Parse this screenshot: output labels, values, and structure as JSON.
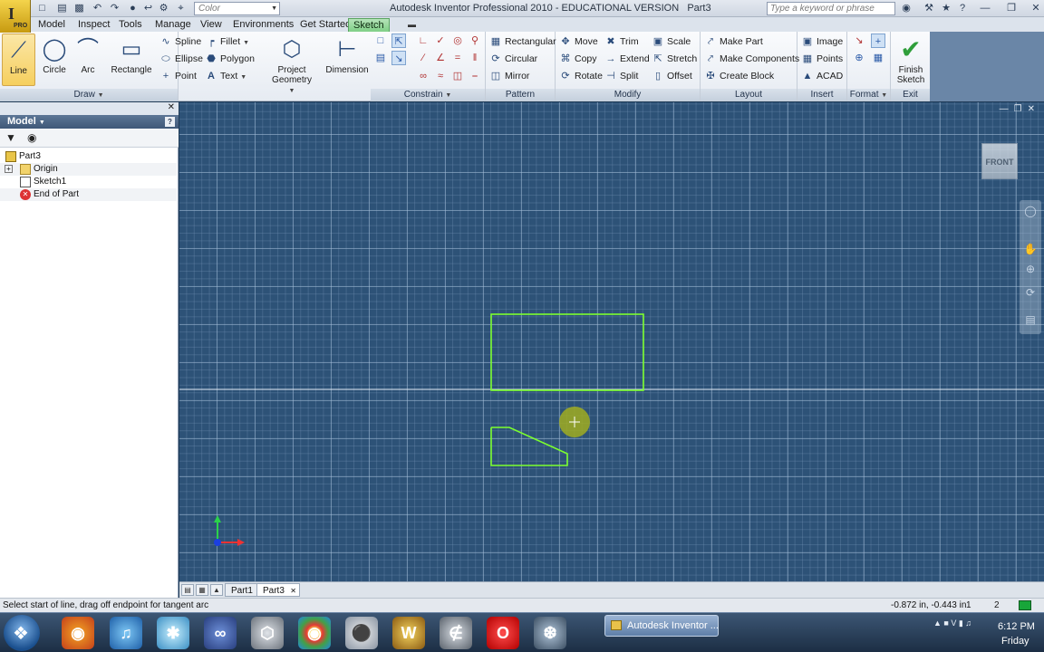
{
  "window": {
    "title": "Autodesk Inventor Professional 2010 - EDUCATIONAL VERSION",
    "doc": "Part3",
    "color_select": "Color",
    "help_search": "Type a keyword or phrase"
  },
  "logo": {
    "letter": "I",
    "pro": "PRO"
  },
  "tabs": [
    "Model",
    "Inspect",
    "Tools",
    "Manage",
    "View",
    "Environments",
    "Get Started",
    "Sketch"
  ],
  "ribbon": {
    "draw": {
      "label": "Draw",
      "line": "Line",
      "circle": "Circle",
      "arc": "Arc",
      "rectangle": "Rectangle",
      "spline": "Spline",
      "ellipse": "Ellipse",
      "point": "Point",
      "fillet": "Fillet",
      "polygon": "Polygon",
      "text": "Text"
    },
    "project": {
      "line1": "Project",
      "line2": "Geometry"
    },
    "dimension": "Dimension",
    "constrain": {
      "label": "Constrain"
    },
    "pattern": {
      "label": "Pattern",
      "rectangular": "Rectangular",
      "circular": "Circular",
      "mirror": "Mirror"
    },
    "modify": {
      "label": "Modify",
      "move": "Move",
      "copy": "Copy",
      "rotate": "Rotate",
      "trim": "Trim",
      "extend": "Extend",
      "split": "Split",
      "scale": "Scale",
      "stretch": "Stretch",
      "offset": "Offset"
    },
    "layout": {
      "label": "Layout",
      "make_part": "Make Part",
      "make_components": "Make Components",
      "create_block": "Create Block"
    },
    "insert": {
      "label": "Insert",
      "image": "Image",
      "points": "Points",
      "acad": "ACAD"
    },
    "format": {
      "label": "Format"
    },
    "exit": {
      "label": "Exit",
      "finish1": "Finish",
      "finish2": "Sketch"
    }
  },
  "browser": {
    "title": "Model",
    "help": "?",
    "tree": [
      "Part3",
      "Origin",
      "Sketch1",
      "End of Part"
    ]
  },
  "viewcube": "FRONT",
  "doc_tabs": [
    "Part1",
    "Part3"
  ],
  "status": {
    "message": "Select start of line, drag off endpoint for tangent arc",
    "coords": "-0.872 in, -0.443 in",
    "n1": "1",
    "n2": "2"
  },
  "taskbar": {
    "task": "Autodesk Inventor ...",
    "time": "6:12 PM",
    "day": "Friday"
  },
  "colors": {
    "sketch_green": "#7cff2e",
    "canvas_bg": "#2d5277",
    "active_tab": "#7fcf86"
  }
}
